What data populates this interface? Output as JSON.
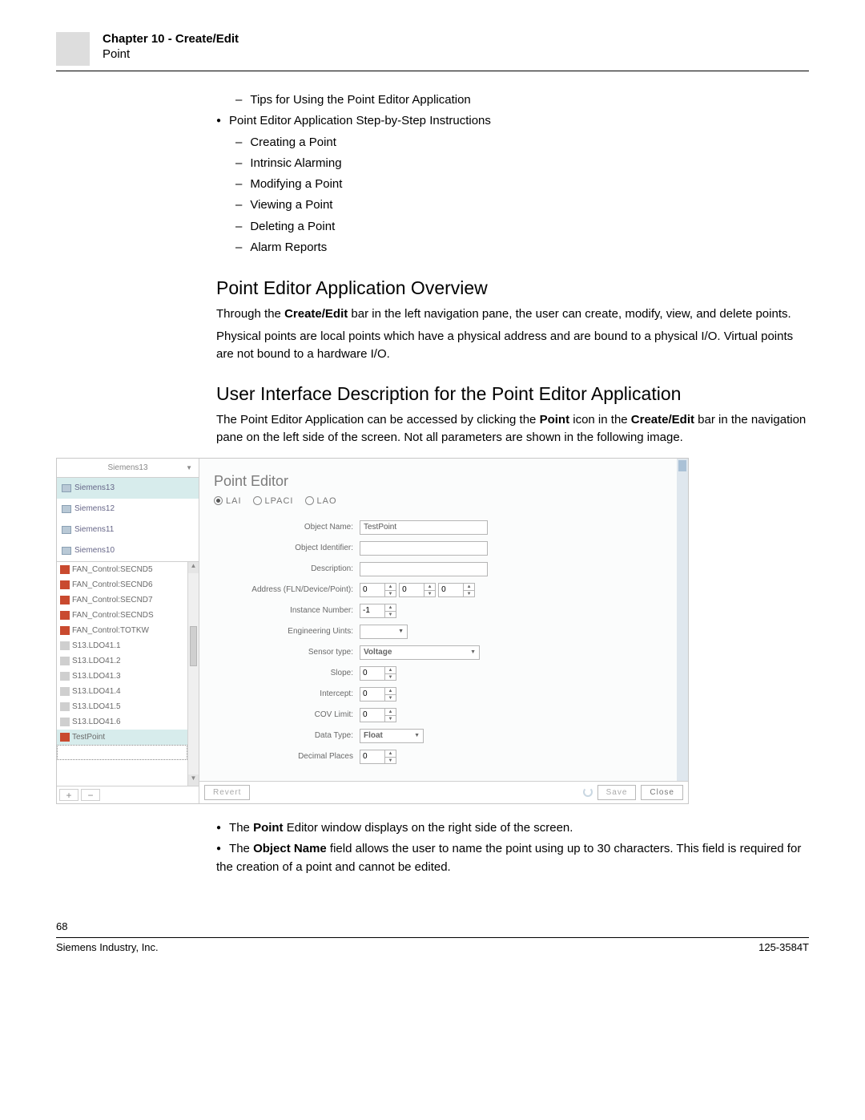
{
  "header": {
    "chapter": "Chapter 10 - Create/Edit",
    "sub": "Point"
  },
  "toc": {
    "first_dash": "Tips for Using the Point Editor Application",
    "bullet": "Point Editor Application Step-by-Step Instructions",
    "dashes": [
      "Creating a Point",
      "Intrinsic Alarming",
      "Modifying a Point",
      "Viewing a Point",
      "Deleting a Point",
      "Alarm Reports"
    ]
  },
  "s1": {
    "title": "Point Editor Application Overview",
    "p1a": "Through the ",
    "p1b": "Create/Edit",
    "p1c": " bar in the left navigation pane, the user can create, modify, view, and delete points.",
    "p2": "Physical points are local points which have a physical address and are bound to a physical I/O. Virtual points are not bound to a hardware I/O."
  },
  "s2": {
    "title": "User Interface Description for the Point Editor Application",
    "p1a": "The Point Editor Application can be accessed by clicking the ",
    "p1b": "Point",
    "p1c": " icon in the ",
    "p1d": "Create/Edit",
    "p1e": " bar in the navigation pane on the left side of the screen. Not all parameters are shown in the following image."
  },
  "app": {
    "dropdown": "Siemens13",
    "topNodes": [
      "Siemens13",
      "Siemens12",
      "Siemens11",
      "Siemens10"
    ],
    "botNodes": [
      {
        "t": "FAN_Control:SECND5",
        "ic": "red"
      },
      {
        "t": "FAN_Control:SECND6",
        "ic": "red"
      },
      {
        "t": "FAN_Control:SECND7",
        "ic": "red"
      },
      {
        "t": "FAN_Control:SECNDS",
        "ic": "red"
      },
      {
        "t": "FAN_Control:TOTKW",
        "ic": "red"
      },
      {
        "t": "S13.LDO41.1",
        "ic": "gray"
      },
      {
        "t": "S13.LDO41.2",
        "ic": "gray"
      },
      {
        "t": "S13.LDO41.3",
        "ic": "gray"
      },
      {
        "t": "S13.LDO41.4",
        "ic": "gray"
      },
      {
        "t": "S13.LDO41.5",
        "ic": "gray"
      },
      {
        "t": "S13.LDO41.6",
        "ic": "gray"
      },
      {
        "t": "TestPoint",
        "ic": "red",
        "sel": true
      }
    ],
    "title": "Point Editor",
    "radios": [
      {
        "l": "LAI",
        "c": true
      },
      {
        "l": "LPACI",
        "c": false
      },
      {
        "l": "LAO",
        "c": false
      }
    ],
    "fields": {
      "objectName": {
        "label": "Object Name:",
        "value": "TestPoint"
      },
      "objectId": {
        "label": "Object Identifier:",
        "value": ""
      },
      "desc": {
        "label": "Description:",
        "value": ""
      },
      "addr": {
        "label": "Address (FLN/Device/Point):",
        "v": [
          "0",
          "0",
          "0"
        ]
      },
      "inst": {
        "label": "Instance Number:",
        "value": "-1"
      },
      "eng": {
        "label": "Engineering Uints:",
        "value": ""
      },
      "sensor": {
        "label": "Sensor type:",
        "value": "Voltage"
      },
      "slope": {
        "label": "Slope:",
        "value": "0"
      },
      "intercept": {
        "label": "Intercept:",
        "value": "0"
      },
      "cov": {
        "label": "COV Limit:",
        "value": "0"
      },
      "dtype": {
        "label": "Data Type:",
        "value": "Float"
      },
      "dec": {
        "label": "Decimal Places",
        "value": "0"
      }
    },
    "buttons": {
      "revert": "Revert",
      "save": "Save",
      "close": "Close"
    },
    "pm": {
      "plus": "+",
      "minus": "−"
    }
  },
  "after": {
    "b1a": "The ",
    "b1b": "Point",
    "b1c": " Editor window displays on the right side of the screen.",
    "b2a": "The ",
    "b2b": "Object Name",
    "b2c": " field allows the user to name the point using up to 30 characters. This field is required for the creation of a point and cannot be edited."
  },
  "footer": {
    "page": "68",
    "left": "Siemens Industry, Inc.",
    "right": "125-3584T"
  }
}
